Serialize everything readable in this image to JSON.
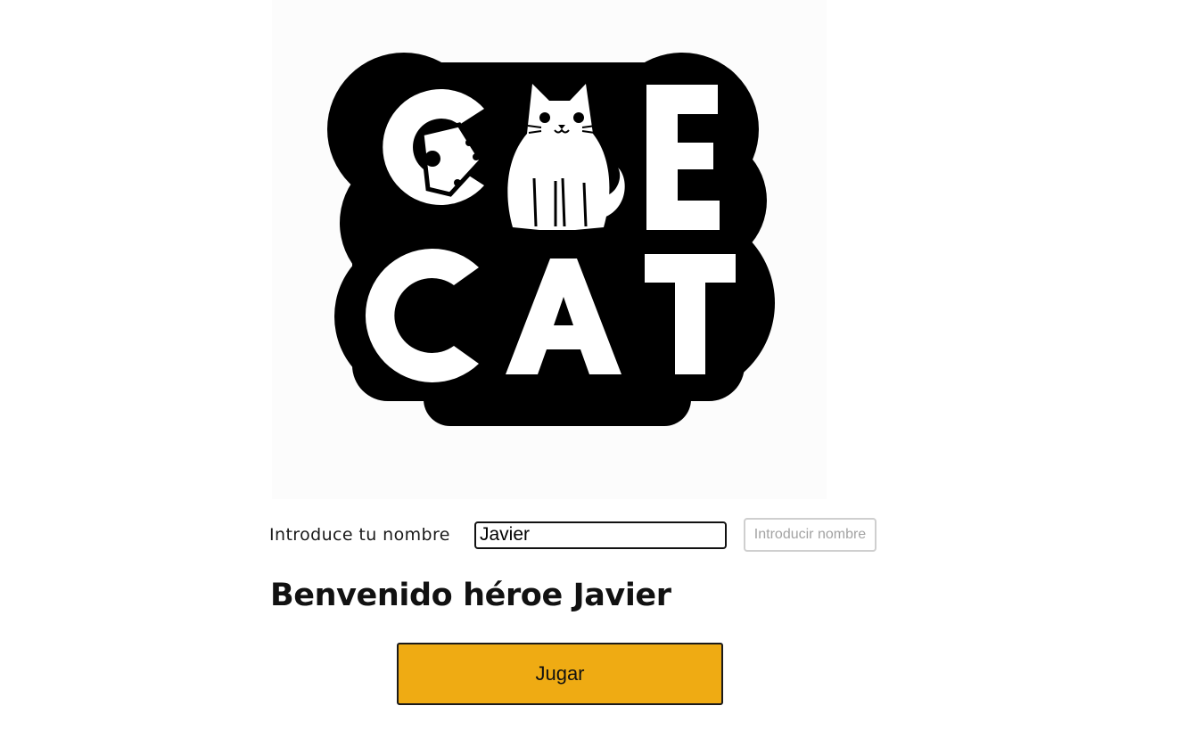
{
  "logo": {
    "line1": "CAE",
    "line2": "CAT",
    "icons": [
      "die-icon",
      "cat-icon"
    ]
  },
  "form": {
    "label": "Introduce tu nombre",
    "input_value": "Javier",
    "button_label": "Introducir nombre"
  },
  "welcome": {
    "text": "Benvenido héroe Javier"
  },
  "play": {
    "label": "Jugar"
  },
  "colors": {
    "play_button": "#efab13",
    "logo_outline": "#000000",
    "logo_fill": "#ffffff"
  }
}
